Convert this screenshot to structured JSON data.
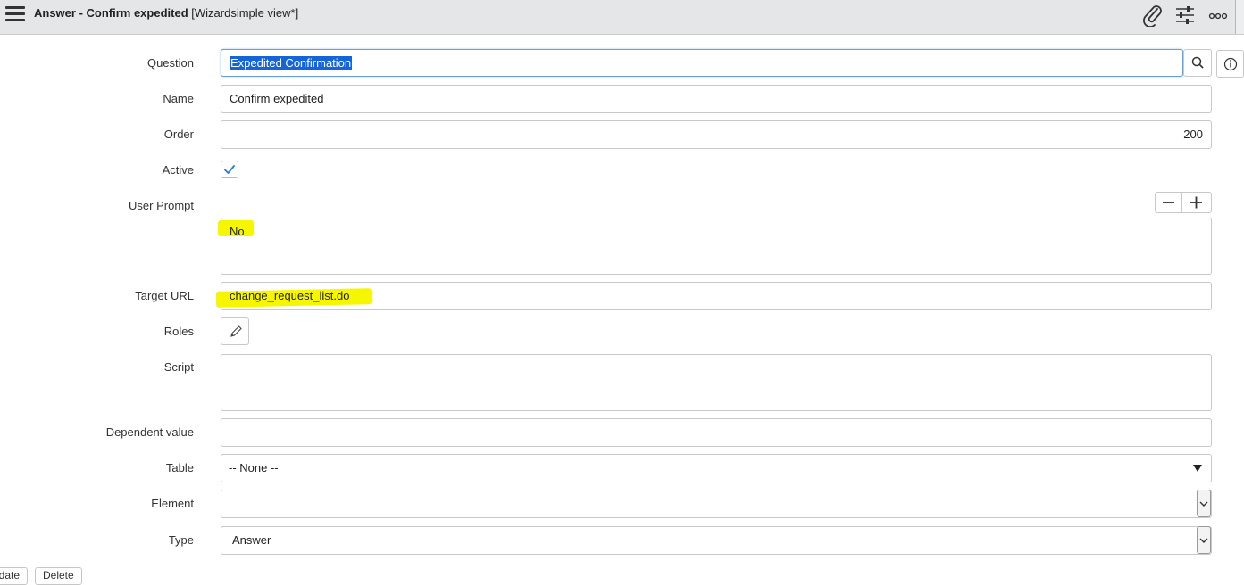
{
  "header": {
    "title": "Answer - Confirm expedited",
    "view": "[Wizardsimple view*]",
    "icons": [
      "menu-icon",
      "attachment-icon",
      "personalize-form-icon",
      "more-options-icon"
    ]
  },
  "form": {
    "question": {
      "label": "Question",
      "value": "Expedited Confirmation",
      "icons": [
        "search-icon",
        "info-icon"
      ]
    },
    "name": {
      "label": "Name",
      "value": "Confirm expedited"
    },
    "order": {
      "label": "Order",
      "value": "200"
    },
    "active": {
      "label": "Active",
      "checked": true
    },
    "user_prompt": {
      "label": "User Prompt",
      "value": "No",
      "icons": [
        "minus-icon",
        "plus-icon"
      ]
    },
    "target_url": {
      "label": "Target URL",
      "value": "change_request_list.do"
    },
    "roles": {
      "label": "Roles",
      "icon": "pencil-icon"
    },
    "script": {
      "label": "Script",
      "value": ""
    },
    "dependent_value": {
      "label": "Dependent value",
      "value": ""
    },
    "table": {
      "label": "Table",
      "value": "-- None --"
    },
    "element": {
      "label": "Element",
      "value": ""
    },
    "type": {
      "label": "Type",
      "value": "Answer"
    }
  },
  "buttons": {
    "update": "date",
    "delete": "Delete"
  },
  "colors": {
    "highlight": "#f6f600",
    "selection": "#1565d8",
    "header_bg": "#e4e6e7",
    "checkmark": "#2a7ad6"
  }
}
